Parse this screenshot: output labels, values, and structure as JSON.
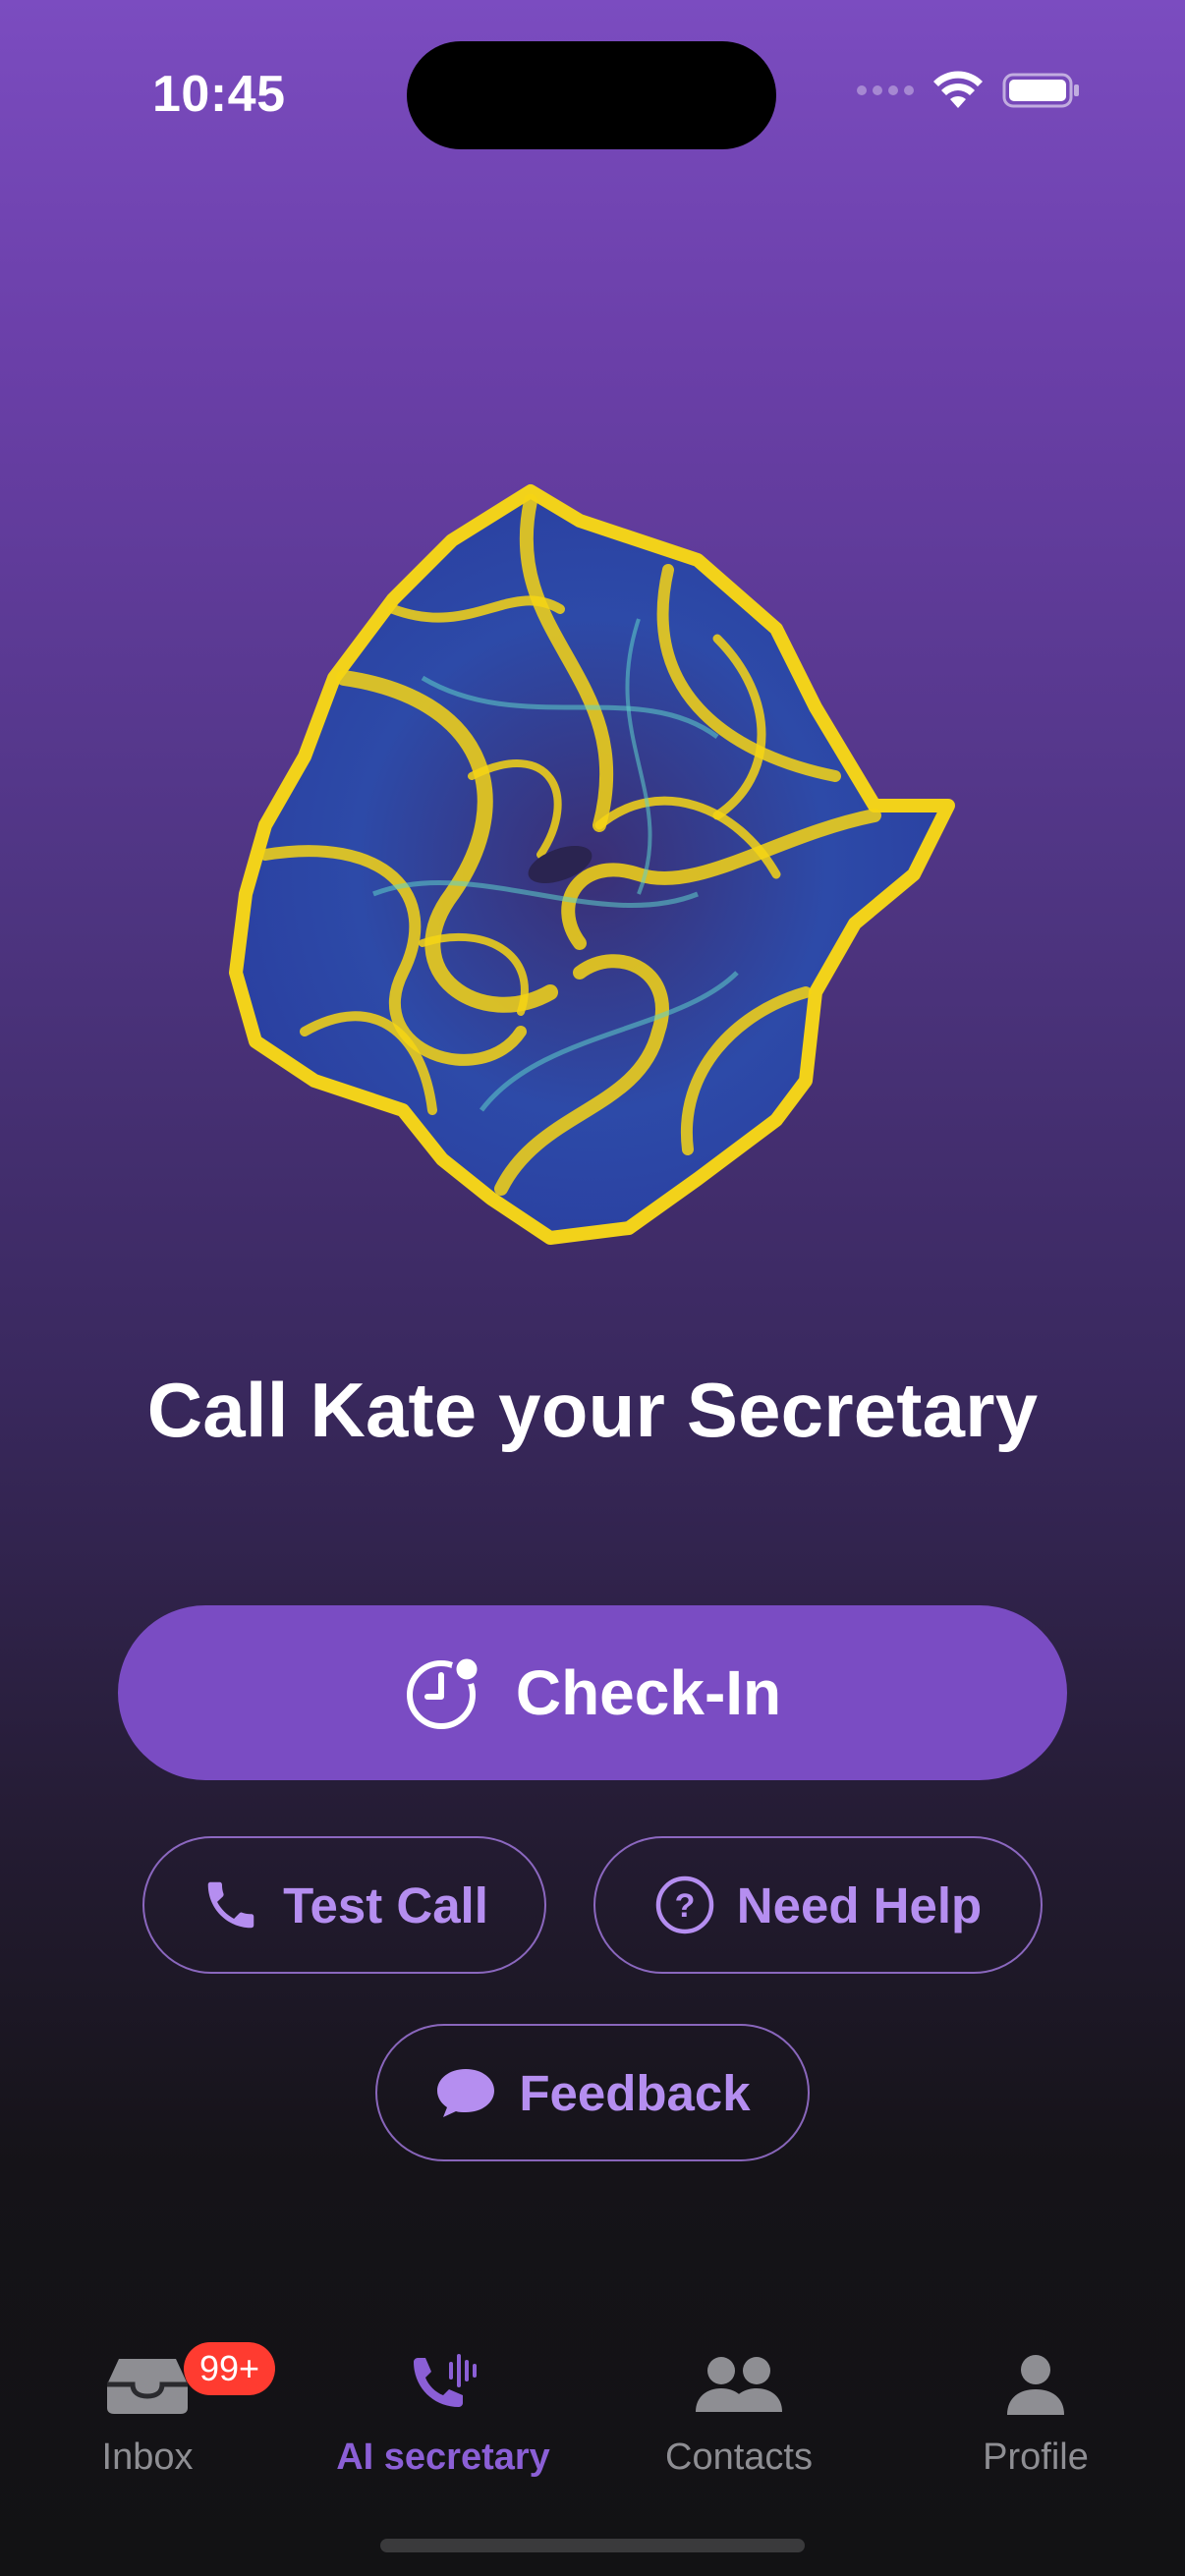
{
  "status_bar": {
    "time": "10:45"
  },
  "hero": {
    "headline": "Call Kate your Secretary"
  },
  "actions": {
    "checkin_label": "Check-In",
    "test_call_label": "Test Call",
    "need_help_label": "Need Help",
    "feedback_label": "Feedback"
  },
  "tab_bar": {
    "tabs": [
      {
        "label": "Inbox",
        "icon": "inbox-tray-icon",
        "badge": "99+"
      },
      {
        "label": "AI secretary",
        "icon": "phone-waveform-icon",
        "active": true
      },
      {
        "label": "Contacts",
        "icon": "people-icon"
      },
      {
        "label": "Profile",
        "icon": "person-icon"
      }
    ]
  },
  "colors": {
    "accent": "#7a4cc3",
    "accent_text": "#b58ef0",
    "badge": "#ff3b30",
    "tab_inactive": "#8e8e93"
  }
}
